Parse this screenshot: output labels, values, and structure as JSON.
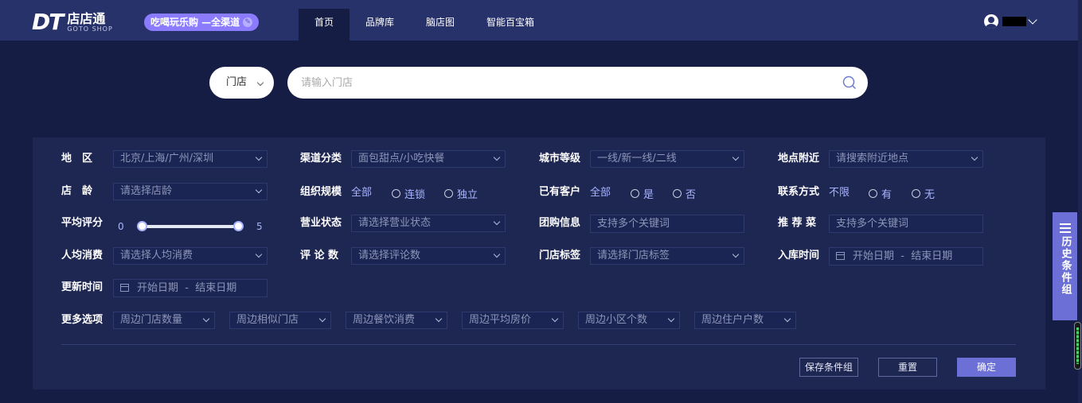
{
  "header": {
    "logo_mark": "DT",
    "logo_cn": "店店通",
    "logo_en": "GOTO SHOP",
    "badge": "吃喝玩乐购 —全渠道",
    "nav": [
      {
        "label": "首页",
        "active": true
      },
      {
        "label": "品牌库",
        "active": false
      },
      {
        "label": "脑店图",
        "active": false
      },
      {
        "label": "智能百宝箱",
        "active": false
      }
    ],
    "user_name": "---"
  },
  "search": {
    "type": "门店",
    "placeholder": "请输入门店"
  },
  "filters": {
    "region": {
      "label": "地　区",
      "value": "北京/上海/广州/深圳"
    },
    "channel": {
      "label": "渠道分类",
      "value": "面包甜点/小吃快餐"
    },
    "city_level": {
      "label": "城市等级",
      "value": "一线/新一线/二线"
    },
    "nearby": {
      "label": "地点附近",
      "value": "请搜索附近地点"
    },
    "age": {
      "label": "店　龄",
      "value": "请选择店龄"
    },
    "org": {
      "label": "组织规模",
      "options": [
        "全部",
        "连锁",
        "独立"
      ]
    },
    "customer": {
      "label": "已有客户",
      "options": [
        "全部",
        "是",
        "否"
      ]
    },
    "contact": {
      "label": "联系方式",
      "options": [
        "不限",
        "有",
        "无"
      ]
    },
    "rating": {
      "label": "平均评分",
      "min": "0",
      "max": "5"
    },
    "status": {
      "label": "营业状态",
      "value": "请选择营业状态"
    },
    "group_buy": {
      "label": "团购信息",
      "placeholder": "支持多个关键词"
    },
    "dish": {
      "label": "推 荐 菜",
      "placeholder": "支持多个关键词"
    },
    "per_capita": {
      "label": "人均消费",
      "value": "请选择人均消费"
    },
    "comments": {
      "label": "评 论 数",
      "value": "请选择评论数"
    },
    "tags": {
      "label": "门店标签",
      "value": "请选择门店标签"
    },
    "stock_time": {
      "label": "入库时间",
      "start": "开始日期",
      "sep": "-",
      "end": "结束日期"
    },
    "update_time": {
      "label": "更新时间",
      "start": "开始日期",
      "sep": "-",
      "end": "结束日期"
    },
    "more": {
      "label": "更多选项",
      "items": [
        "周边门店数量",
        "周边相似门店",
        "周边餐饮消费",
        "周边平均房价",
        "周边小区个数",
        "周边住户户数"
      ]
    }
  },
  "actions": {
    "save": "保存条件组",
    "reset": "重置",
    "confirm": "确定"
  },
  "side_tab": {
    "label": "历史条件组"
  },
  "colors": {
    "accent": "#6b6fd6",
    "header": "#28326a",
    "background": "#161d45",
    "panel": "#1e2652"
  }
}
